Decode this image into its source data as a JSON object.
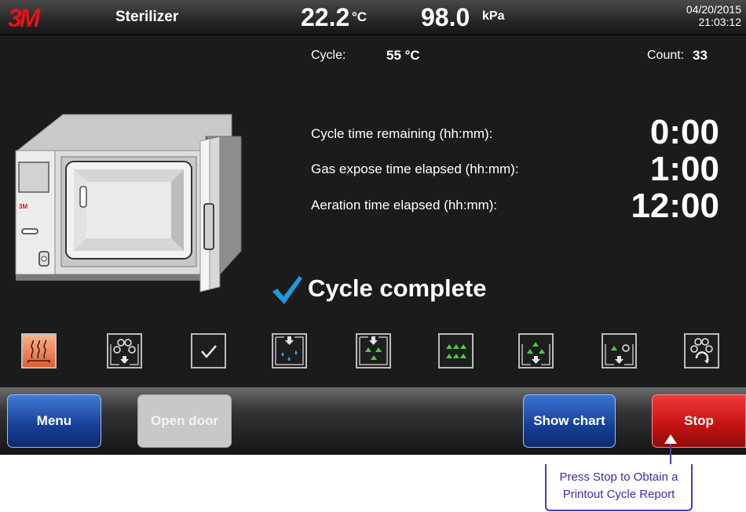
{
  "header": {
    "logo": "3M",
    "title": "Sterilizer",
    "temperature_value": "22.2",
    "temperature_unit": "°C",
    "pressure_value": "98.0",
    "pressure_unit": "kPa",
    "date": "04/20/2015",
    "time": "21:03:12"
  },
  "cycle": {
    "label": "Cycle:",
    "value": "55 °C",
    "count_label": "Count:",
    "count_value": "33"
  },
  "timers": [
    {
      "label": "Cycle time remaining (hh:mm):",
      "value": "0:00"
    },
    {
      "label": "Gas expose time elapsed (hh:mm):",
      "value": "1:00"
    },
    {
      "label": "Aeration time elapsed (hh:mm):",
      "value": "12:00"
    }
  ],
  "status": {
    "text": "Cycle complete"
  },
  "sterilizer_image": {
    "logo": "3M"
  },
  "stages": [
    {
      "name": "heating-stage-icon",
      "active": true
    },
    {
      "name": "vacuum-stage-icon",
      "active": false
    },
    {
      "name": "leak-check-stage-icon",
      "active": false
    },
    {
      "name": "humidification-stage-icon",
      "active": false
    },
    {
      "name": "gas-injection-stage-icon",
      "active": false
    },
    {
      "name": "gas-exposure-stage-icon",
      "active": false
    },
    {
      "name": "gas-exhaust-stage-icon",
      "active": false
    },
    {
      "name": "air-wash-stage-icon",
      "active": false
    },
    {
      "name": "aeration-stage-icon",
      "active": false
    }
  ],
  "buttons": {
    "menu": "Menu",
    "open_door": "Open door",
    "show_chart": "Show chart",
    "stop": "Stop"
  },
  "callout": {
    "line1": "Press Stop to Obtain a",
    "line2": "Printout Cycle Report"
  },
  "colors": {
    "check": "#1c9be0",
    "stop": "#d01818",
    "nav_blue": "#173f94",
    "gas": "#4fc94a",
    "drops": "#4a9be8",
    "heat": "#e86a3a"
  }
}
